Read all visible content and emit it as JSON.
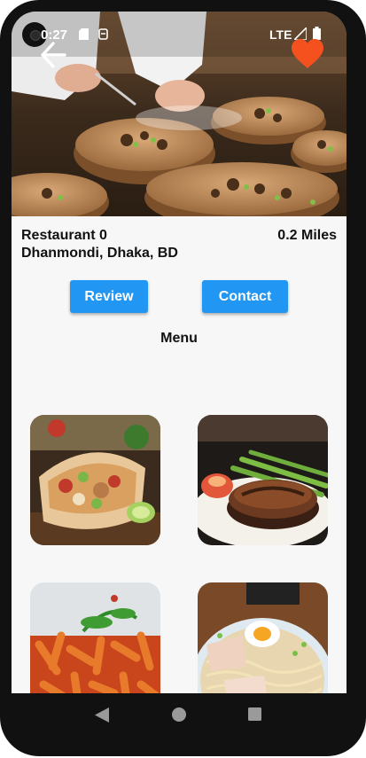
{
  "status_bar": {
    "time": "0:27",
    "network": "LTE"
  },
  "header": {
    "back_icon": "arrow-left-icon",
    "favorite_icon": "heart-icon",
    "favorite_color": "#f4511e"
  },
  "restaurant": {
    "name": "Restaurant 0",
    "address": "Dhanmondi, Dhaka, BD",
    "distance": "0.2 Miles"
  },
  "actions": {
    "review_label": "Review",
    "contact_label": "Contact",
    "button_color": "#2196f3"
  },
  "menu": {
    "title": "Menu",
    "items": [
      {
        "image": "burrito-wrap-photo"
      },
      {
        "image": "glazed-steak-photo"
      },
      {
        "image": "penne-pasta-photo"
      },
      {
        "image": "ramen-bowl-photo"
      }
    ]
  },
  "system_nav": {
    "back_icon": "triangle-back-icon",
    "home_icon": "circle-home-icon",
    "recents_icon": "square-recents-icon"
  }
}
